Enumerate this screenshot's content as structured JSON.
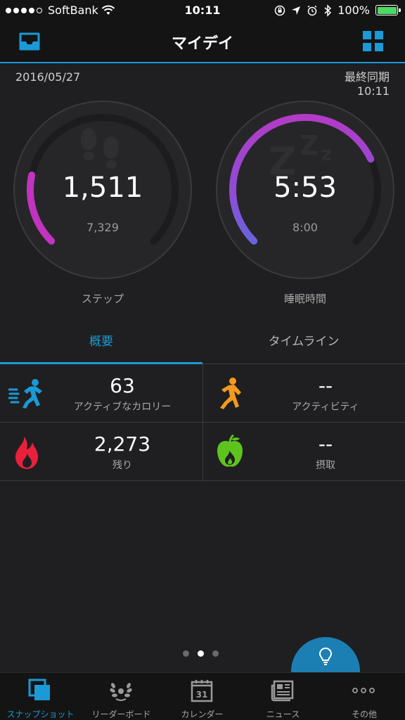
{
  "status_bar": {
    "carrier": "SoftBank",
    "time": "10:11",
    "battery": "100%"
  },
  "nav": {
    "title": "マイデイ",
    "left_icon": "inbox-icon",
    "right_icon": "grid-icon"
  },
  "summary": {
    "date": "2016/05/27",
    "sync_label": "最終同期",
    "sync_time": "10:11"
  },
  "gauges": {
    "steps": {
      "value": "1,511",
      "goal": "7,329",
      "label": "ステップ",
      "progress": 0.21
    },
    "sleep": {
      "value": "5:53",
      "goal": "8:00",
      "label": "睡眠時間",
      "progress": 0.74
    }
  },
  "tabs": {
    "overview": "概要",
    "timeline": "タイムライン"
  },
  "stats": {
    "active_calories": {
      "value": "63",
      "label": "アクティブなカロリー"
    },
    "activity": {
      "value": "--",
      "label": "アクティビティ"
    },
    "remaining": {
      "value": "2,273",
      "label": "残り"
    },
    "intake": {
      "value": "--",
      "label": "摂取"
    }
  },
  "tabbar": {
    "snapshot": "スナップショット",
    "leaderboard": "リーダーボード",
    "calendar": "カレンダー",
    "calendar_day": "31",
    "news": "ニュース",
    "more": "その他"
  },
  "colors": {
    "accent": "#1a9ad6",
    "steps_arc": "#c034c0",
    "sleep_arc_start": "#c034c0",
    "sleep_arc_end": "#3f7fe0",
    "activity_orange": "#f39a1e",
    "calorie_red": "#e8203c",
    "intake_green": "#5fc31e"
  }
}
